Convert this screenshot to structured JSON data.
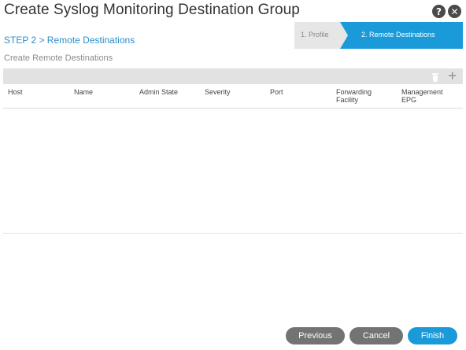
{
  "dialog": {
    "title": "Create Syslog Monitoring Destination Group",
    "help_glyph": "?",
    "close_glyph": "✕"
  },
  "step": {
    "label": "STEP 2 > Remote Destinations"
  },
  "wizard": {
    "steps": [
      "1. Profile",
      "2. Remote Destinations"
    ],
    "active_color": "#1a9ad8",
    "inactive_color": "#e6e6e6"
  },
  "section": {
    "title": "Create Remote Destinations"
  },
  "toolbar": {
    "add_glyph": "+"
  },
  "table": {
    "columns": [
      "Host",
      "Name",
      "Admin State",
      "Severity",
      "Port",
      "Forwarding Facility",
      "Management EPG"
    ],
    "rows": []
  },
  "footer": {
    "previous_label": "Previous",
    "cancel_label": "Cancel",
    "finish_label": "Finish"
  }
}
